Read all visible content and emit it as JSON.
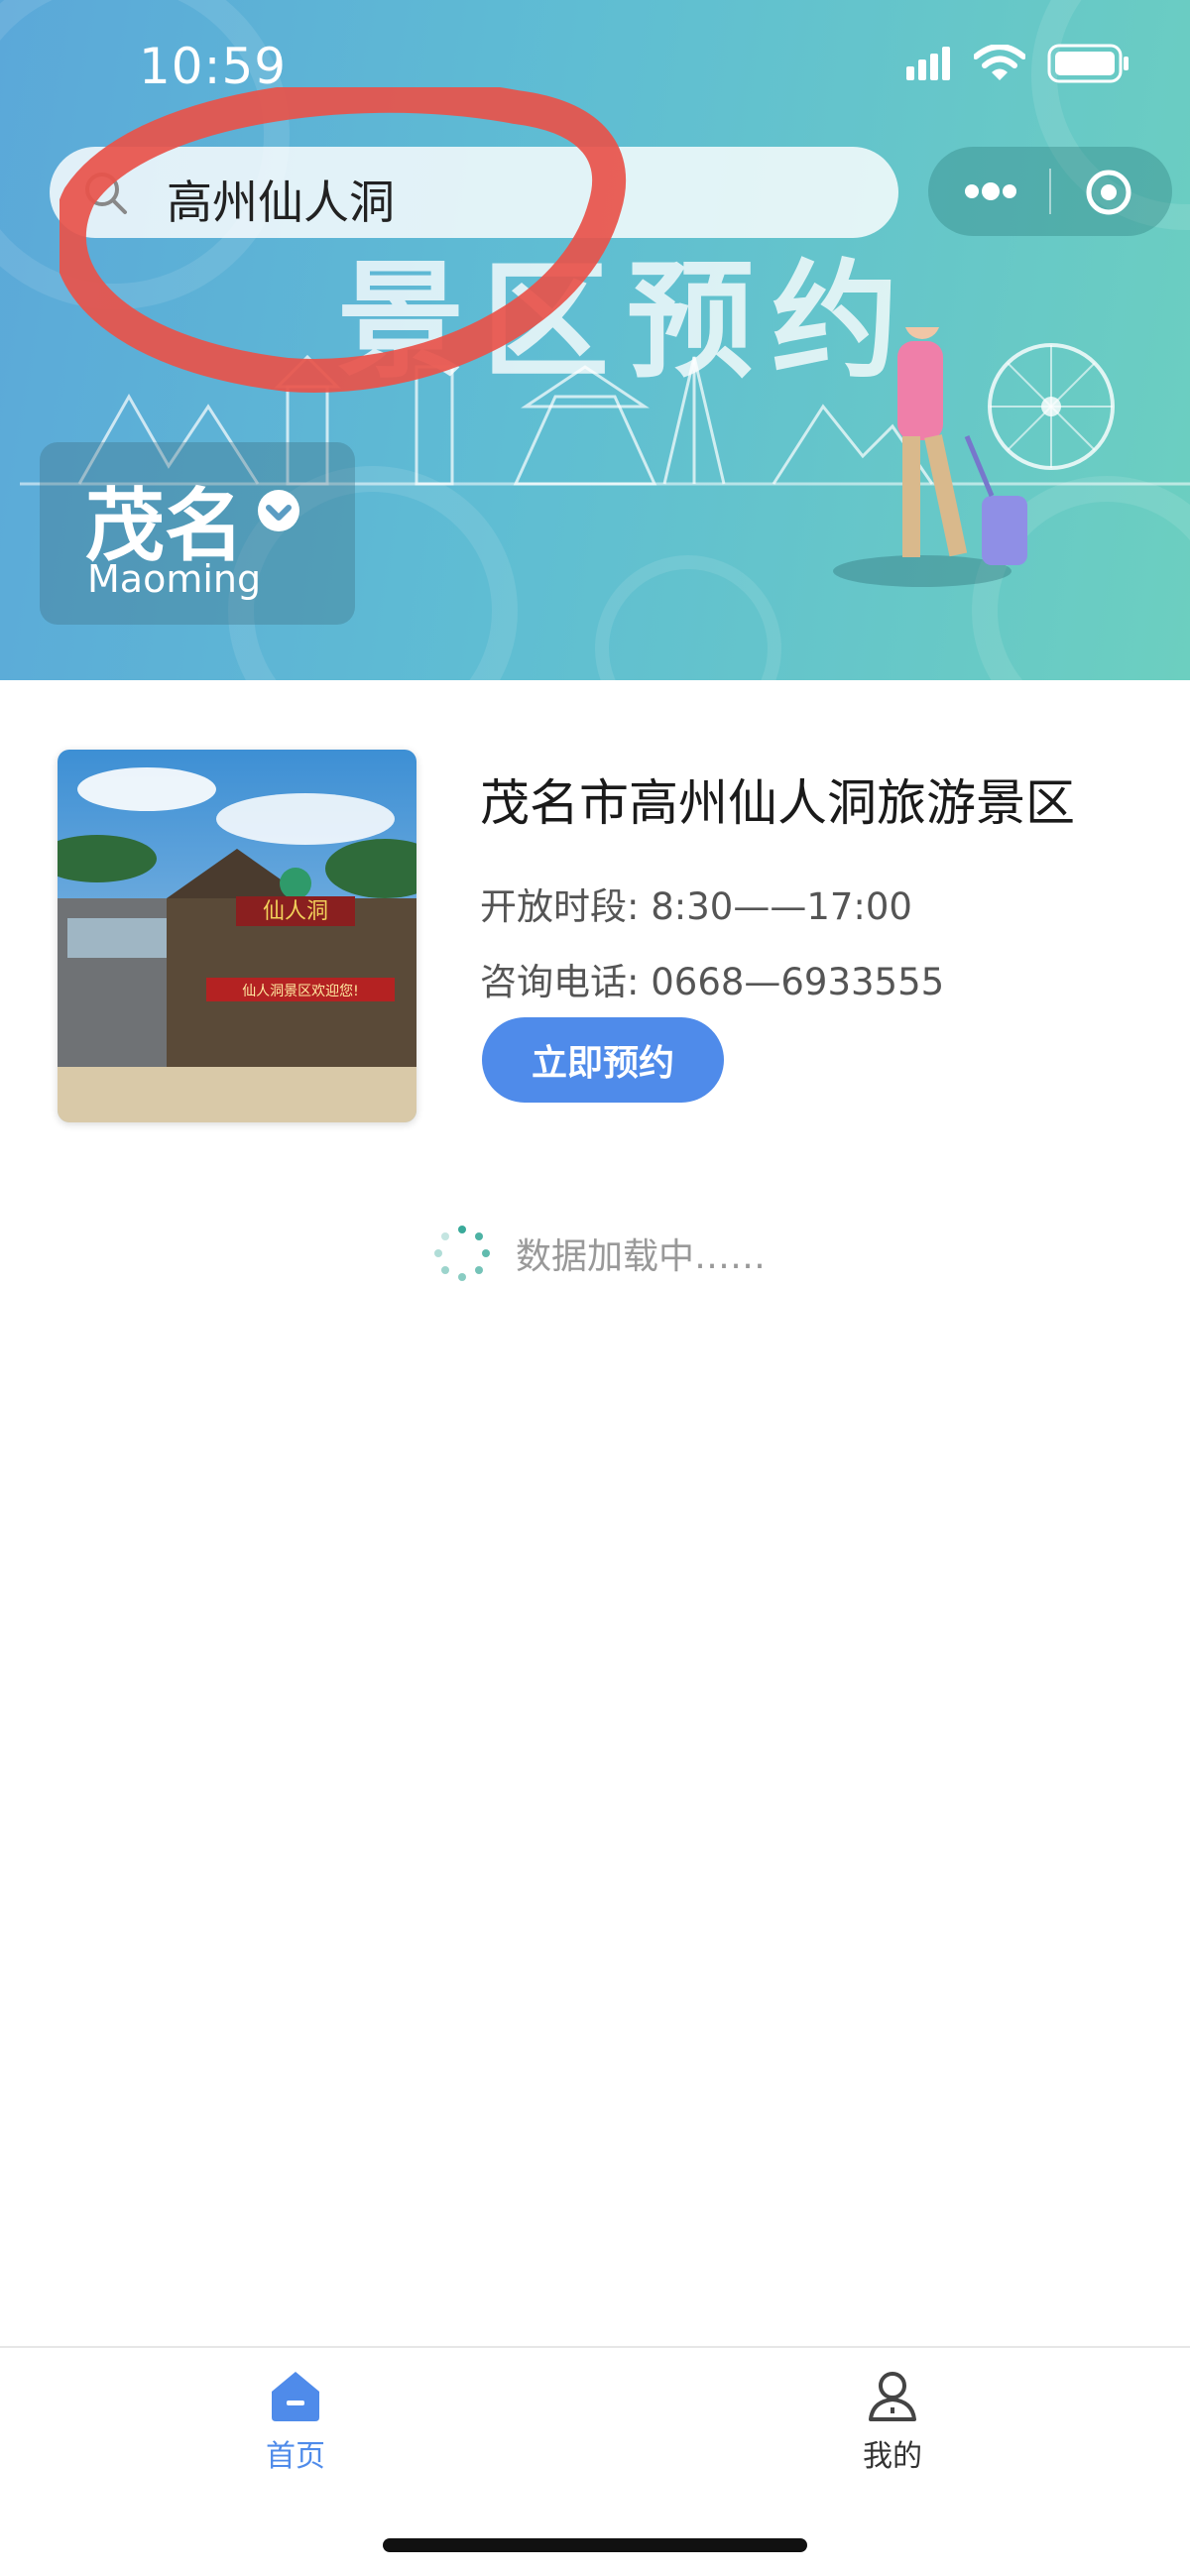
{
  "status_bar": {
    "time": "10:59"
  },
  "search": {
    "value": "高州仙人洞"
  },
  "banner": {
    "title": "景区预约"
  },
  "city": {
    "name": "茂名",
    "english": "Maoming"
  },
  "scenic_spot": {
    "name": "茂名市高州仙人洞旅游景区",
    "hours_label": "开放时段:",
    "hours": "8:30——17:00",
    "phone_label": "咨询电话:",
    "phone": "0668—6933555",
    "book_button": "立即预约",
    "image_sign": "仙人洞",
    "image_banner": "仙人洞景区欢迎您!"
  },
  "loading": {
    "text": "数据加载中……"
  },
  "tabbar": {
    "items": [
      {
        "label": "首页",
        "icon": "home-icon",
        "active": true
      },
      {
        "label": "我的",
        "icon": "user-icon",
        "active": false
      }
    ]
  },
  "colors": {
    "accent": "#4f8bea",
    "annotation_red": "#e8524a",
    "hero_start": "#5ba8d9",
    "hero_end": "#6ccfc0"
  }
}
